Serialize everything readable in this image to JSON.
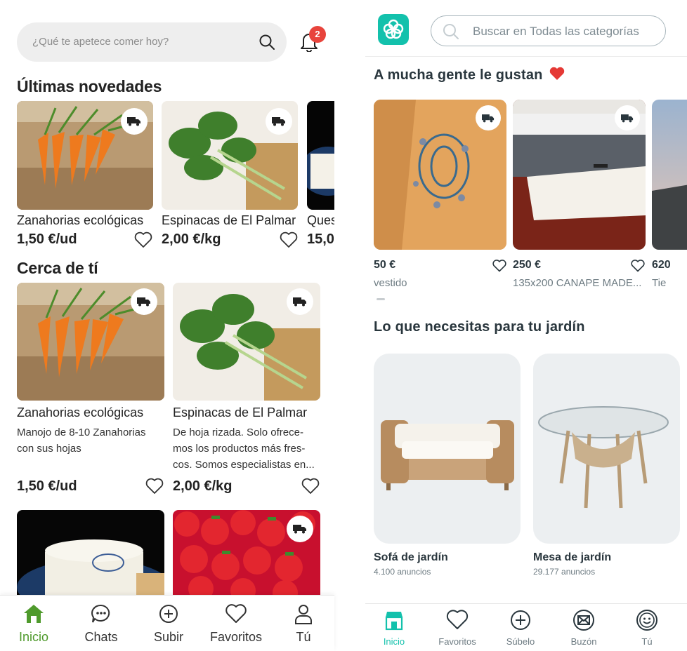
{
  "left": {
    "search": {
      "placeholder": "¿Qué te apetece comer hoy?"
    },
    "notifications": {
      "count": "2"
    },
    "latest": {
      "title": "Últimas novedades",
      "items": [
        {
          "name": "Zanahorias ecológicas",
          "price": "1,50 €/ud"
        },
        {
          "name": "Espinacas de El Palmar",
          "price": "2,00 €/kg"
        },
        {
          "name": "Ques",
          "price": "15,0"
        }
      ]
    },
    "nearby": {
      "title": "Cerca de tí",
      "items": [
        {
          "name": "Zanahorias ecológicas",
          "desc": [
            "Manojo de 8-10 Zanahorias",
            "con sus hojas"
          ],
          "price": "1,50 €/ud"
        },
        {
          "name": "Espinacas de El Palmar",
          "desc": [
            "De hoja rizada. Solo ofrece-",
            "mos los productos más fres-",
            "cos. Somos especialistas en..."
          ],
          "price": "2,00 €/kg"
        }
      ]
    },
    "nav": [
      {
        "label": "Inicio",
        "icon": "home-icon",
        "active": true
      },
      {
        "label": "Chats",
        "icon": "chat-icon"
      },
      {
        "label": "Subir",
        "icon": "plus-circle-icon"
      },
      {
        "label": "Favoritos",
        "icon": "heart-icon"
      },
      {
        "label": "Tú",
        "icon": "user-icon"
      }
    ],
    "colors": {
      "accent": "#4f9a2c",
      "badge": "#e8443c"
    }
  },
  "right": {
    "search": {
      "placeholder": "Buscar en Todas las categorías"
    },
    "popular": {
      "title": "A mucha gente le gustan",
      "items": [
        {
          "price": "50 €",
          "title": "vestido"
        },
        {
          "price": "250 €",
          "title": "135x200 CANAPE MADE..."
        },
        {
          "price": "620",
          "title": "Tie"
        }
      ]
    },
    "garden": {
      "title": "Lo que necesitas para tu jardín",
      "items": [
        {
          "name": "Sofá de jardín",
          "count": "4.100 anuncios"
        },
        {
          "name": "Mesa de jardín",
          "count": "29.177 anuncios"
        }
      ]
    },
    "nav": [
      {
        "label": "Inicio",
        "icon": "home-store-icon",
        "active": true
      },
      {
        "label": "Favoritos",
        "icon": "heart-icon"
      },
      {
        "label": "Súbelo",
        "icon": "plus-circle-icon"
      },
      {
        "label": "Buzón",
        "icon": "mail-icon"
      },
      {
        "label": "Tú",
        "icon": "smiley-icon"
      }
    ],
    "colors": {
      "accent": "#13c1ac",
      "heart_emoji": "#e53935"
    }
  }
}
